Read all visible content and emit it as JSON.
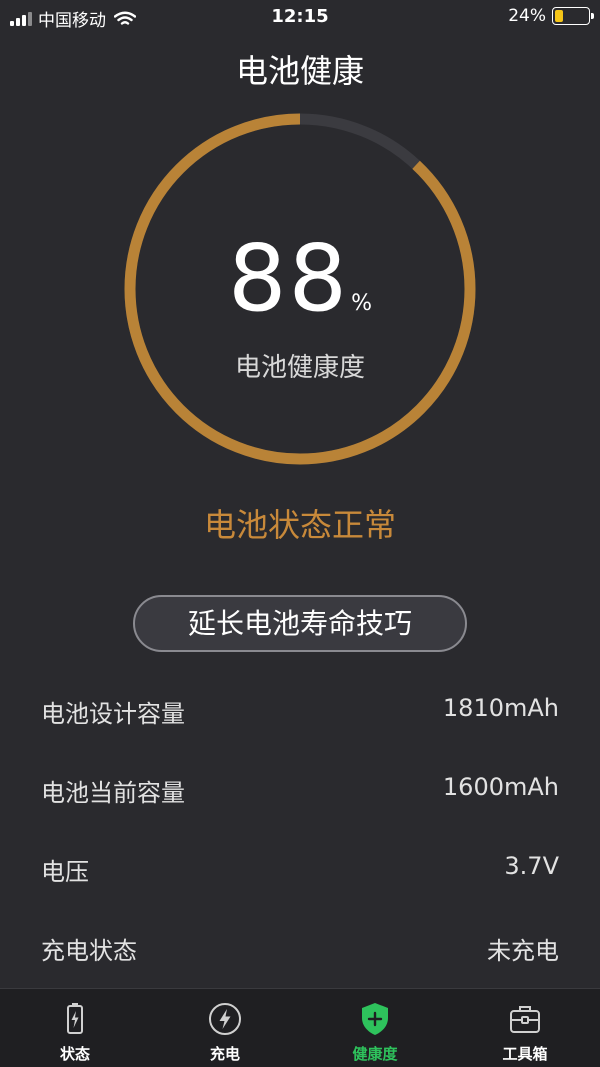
{
  "status_bar": {
    "carrier": "中国移动",
    "time": "12:15",
    "battery_percent_text": "24%",
    "battery_level": 0.24
  },
  "header": {
    "title": "电池健康"
  },
  "gauge": {
    "value": "88",
    "unit": "%",
    "label": "电池健康度",
    "fraction": 0.88,
    "track_color": "#3b3b40",
    "fill_color": "#b98337"
  },
  "state": {
    "text": "电池状态正常",
    "color": "#c8893a"
  },
  "tips_button": {
    "label": "延长电池寿命技巧"
  },
  "info": [
    {
      "label": "电池设计容量",
      "value": "1810mAh"
    },
    {
      "label": "电池当前容量",
      "value": "1600mAh"
    },
    {
      "label": "电压",
      "value": "3.7V"
    },
    {
      "label": "充电状态",
      "value": "未充电"
    }
  ],
  "tabs": [
    {
      "label": "状态",
      "icon": "battery-icon",
      "active": false
    },
    {
      "label": "充电",
      "icon": "lightning-icon",
      "active": false
    },
    {
      "label": "健康度",
      "icon": "shield-plus-icon",
      "active": true
    },
    {
      "label": "工具箱",
      "icon": "toolbox-icon",
      "active": false
    }
  ],
  "colors": {
    "accent": "#c8893a",
    "active_tab": "#2ec25c",
    "background": "#2a2a2e"
  }
}
